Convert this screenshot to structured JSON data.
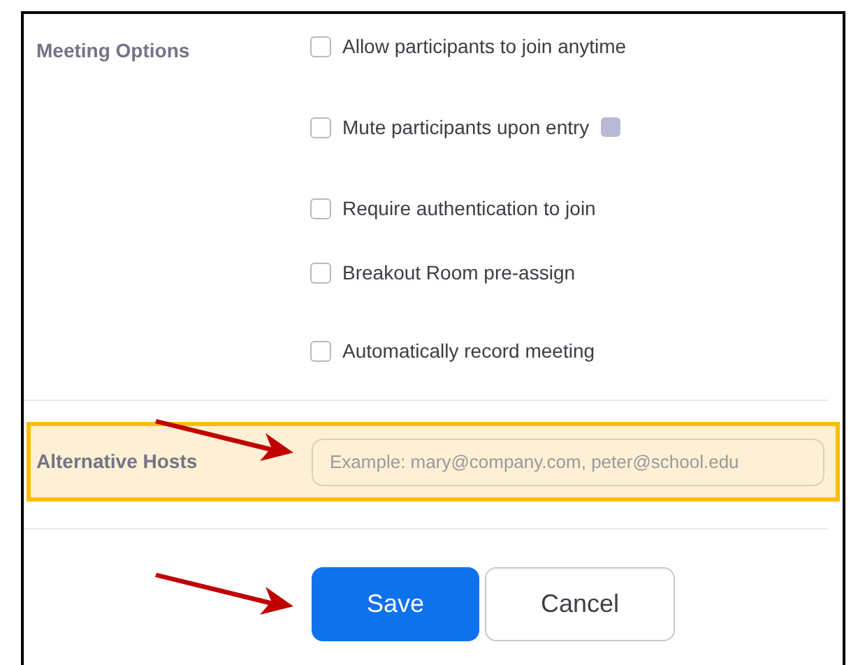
{
  "meeting_options": {
    "label": "Meeting Options",
    "options": [
      {
        "label": "Allow participants to join anytime",
        "checked": false,
        "badge": false
      },
      {
        "label": "Mute participants upon entry",
        "checked": false,
        "badge": true
      },
      {
        "label": "Require authentication to join",
        "checked": false,
        "badge": false
      },
      {
        "label": "Breakout Room pre-assign",
        "checked": false,
        "badge": false
      },
      {
        "label": "Automatically record meeting",
        "checked": false,
        "badge": false
      }
    ]
  },
  "alternative_hosts": {
    "label": "Alternative Hosts",
    "placeholder": "Example: mary@company.com, peter@school.edu",
    "highlighted": true
  },
  "buttons": [
    {
      "label": "Save",
      "kind": "primary"
    },
    {
      "label": "Cancel",
      "kind": "secondary"
    }
  ]
}
